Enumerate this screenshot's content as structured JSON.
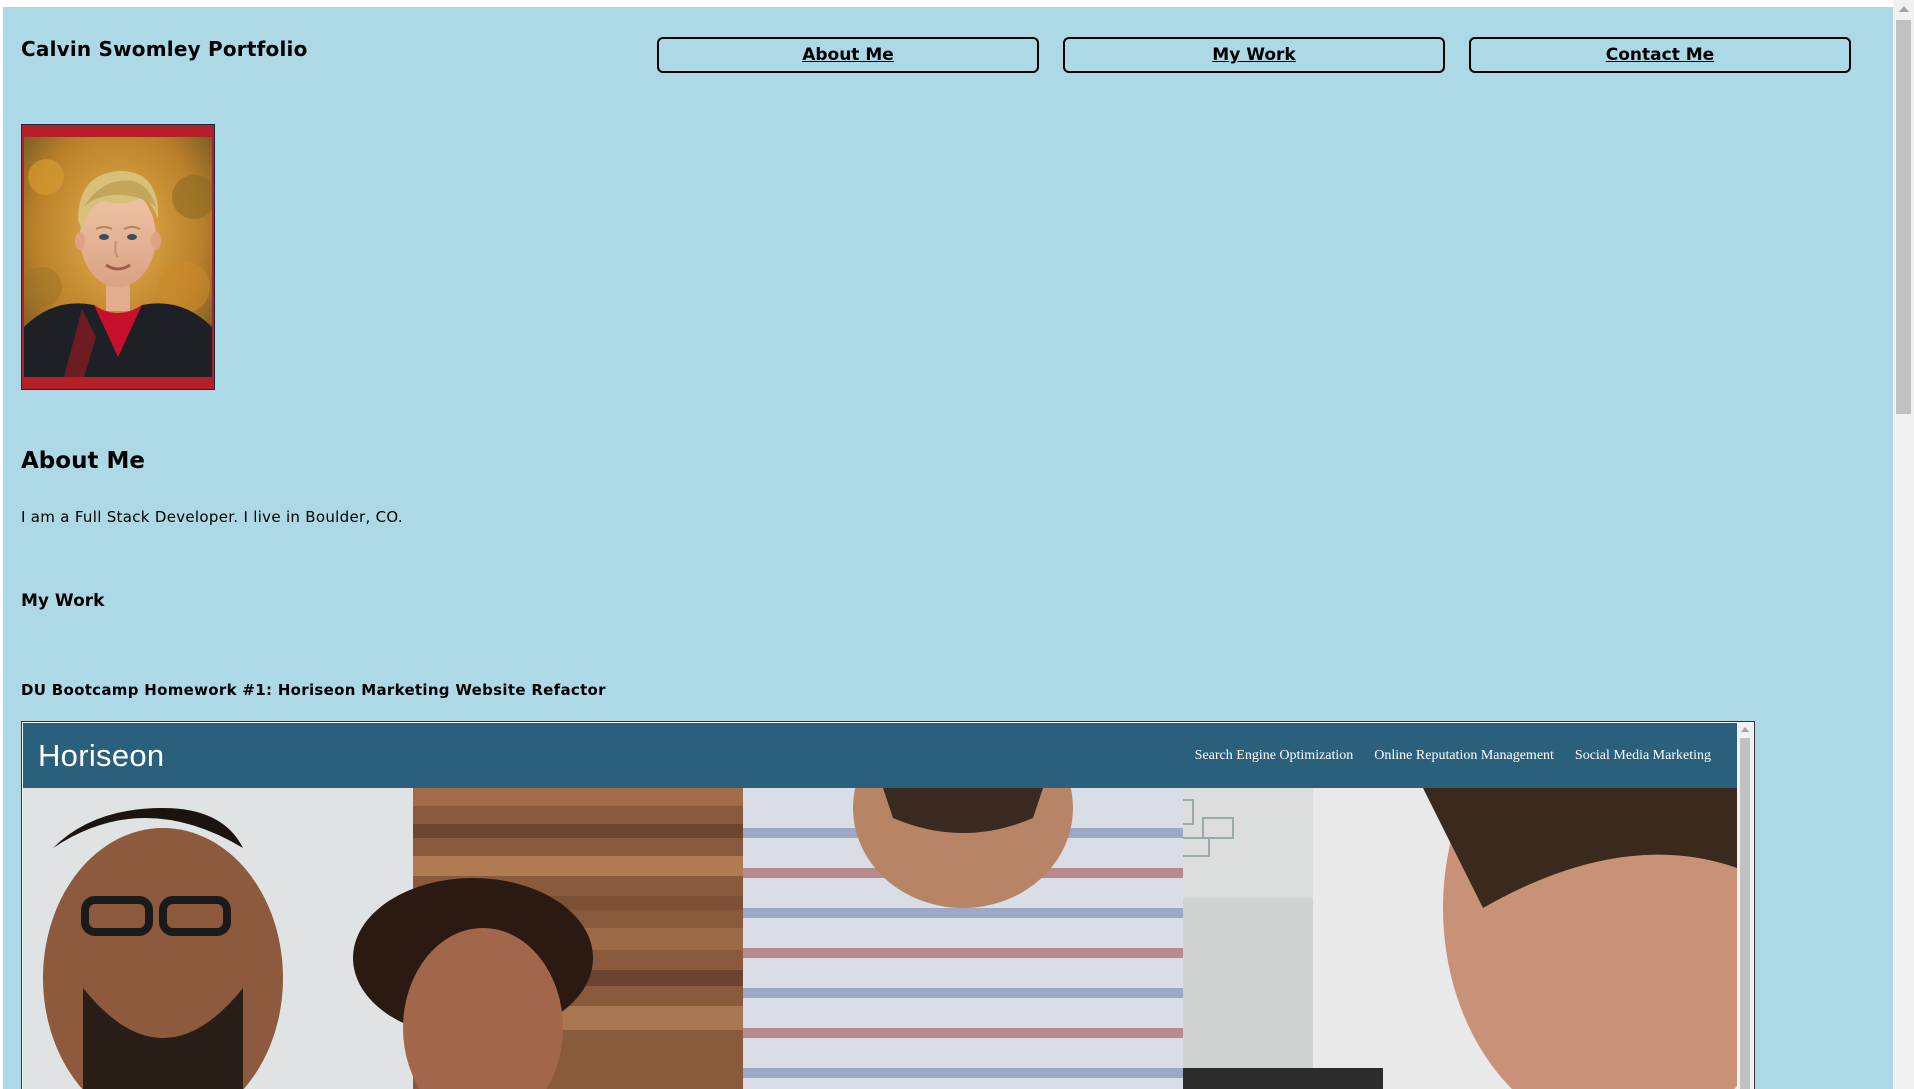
{
  "header": {
    "site_title": "Calvin Swomley Portfolio",
    "nav": [
      {
        "label": "About Me"
      },
      {
        "label": "My Work"
      },
      {
        "label": "Contact Me"
      }
    ]
  },
  "about": {
    "heading": "About Me",
    "text": "I am a Full Stack Developer. I live in Boulder, CO."
  },
  "work": {
    "heading": "My Work",
    "projects": [
      {
        "title": "DU Bootcamp Homework #1: Horiseon Marketing Website Refactor",
        "preview": {
          "logo": "Horiseon",
          "nav": [
            "Search Engine Optimization",
            "Online Reputation Management",
            "Social Media Marketing"
          ]
        }
      }
    ]
  },
  "colors": {
    "page_background": "#add8e6",
    "horiseon_header": "#2a607c",
    "photo_frame": "#b52028"
  },
  "icons": {
    "scroll_up": "scroll-up-arrow-icon"
  }
}
